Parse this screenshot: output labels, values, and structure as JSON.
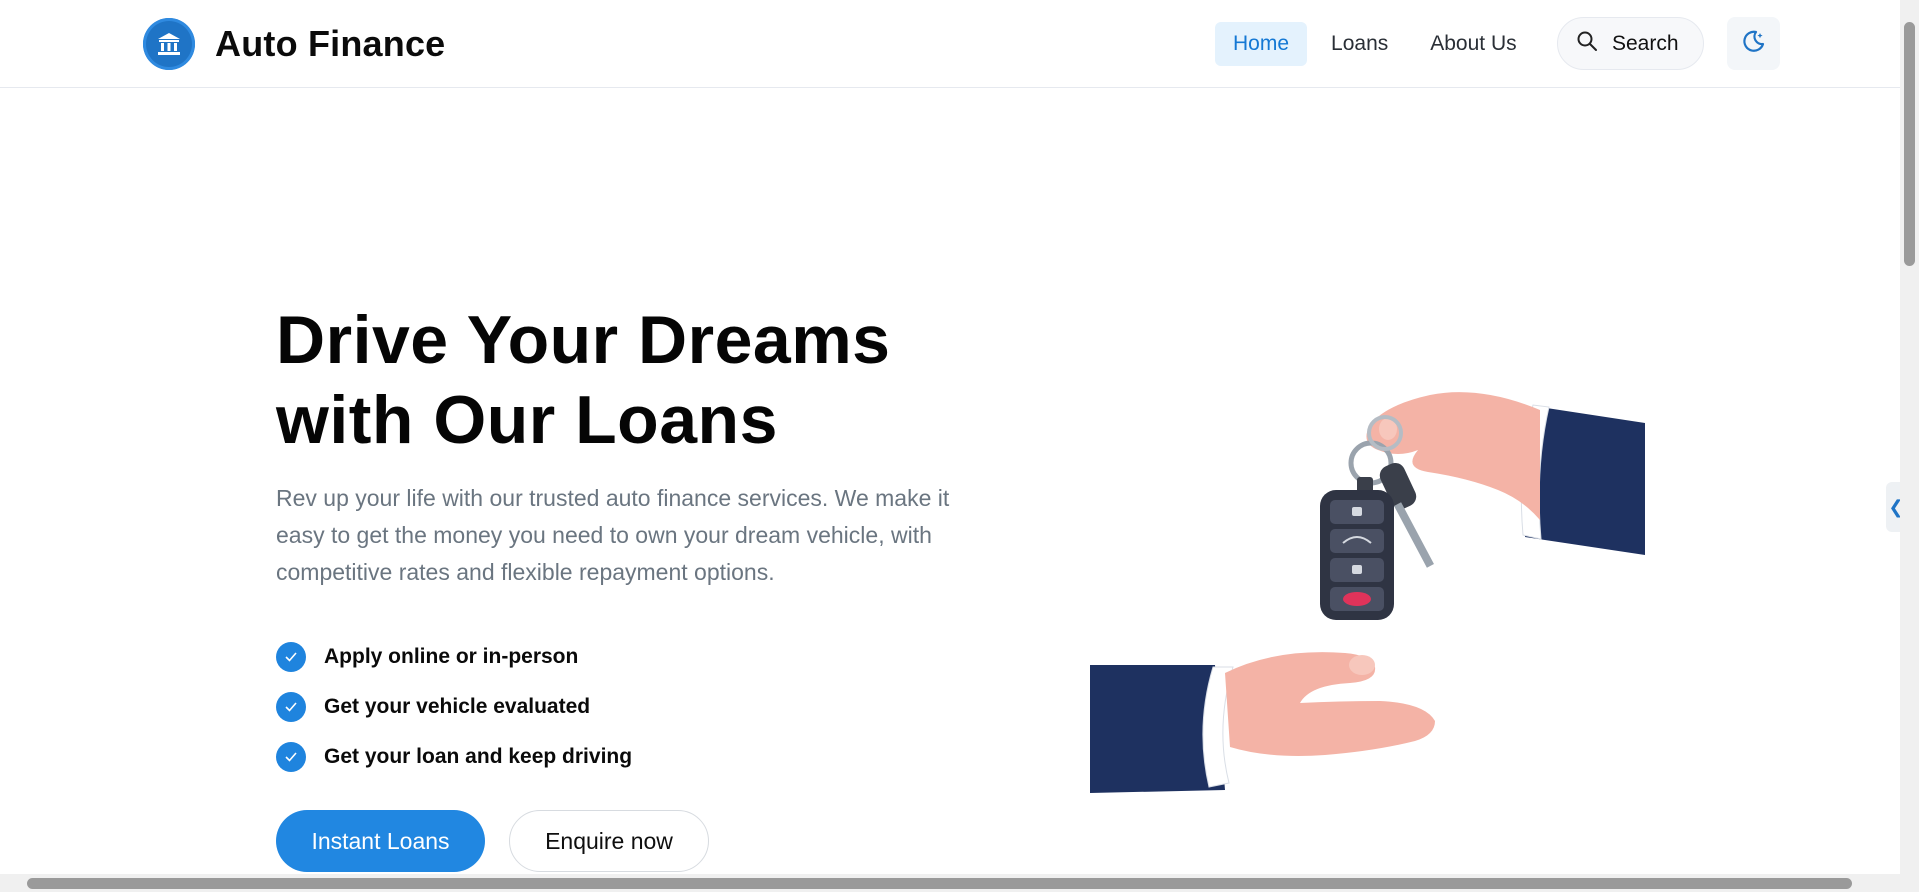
{
  "brand": {
    "name": "Auto Finance",
    "logo_icon": "bank-icon",
    "accent_color": "#2187e1"
  },
  "nav": {
    "items": [
      {
        "label": "Home",
        "active": true
      },
      {
        "label": "Loans",
        "active": false
      },
      {
        "label": "About Us",
        "active": false
      }
    ],
    "search_label": "Search",
    "search_icon": "search-icon",
    "theme_icon": "moon-icon"
  },
  "hero": {
    "headline_part1": "Drive Your ",
    "headline_highlight": "Dreams",
    "headline_part2": "with Our Loans",
    "description": "Rev up your life with our trusted auto finance services. We make it easy to get the money you need to own your dream vehicle, with competitive rates and flexible repayment options.",
    "features": [
      "Apply online or in-person",
      "Get your vehicle evaluated",
      "Get your loan and keep driving"
    ],
    "primary_button": "Instant Loans",
    "secondary_button": "Enquire now",
    "illustration": "hands-passing-car-keys"
  },
  "side_tab_icon": "chevron-left-icon"
}
